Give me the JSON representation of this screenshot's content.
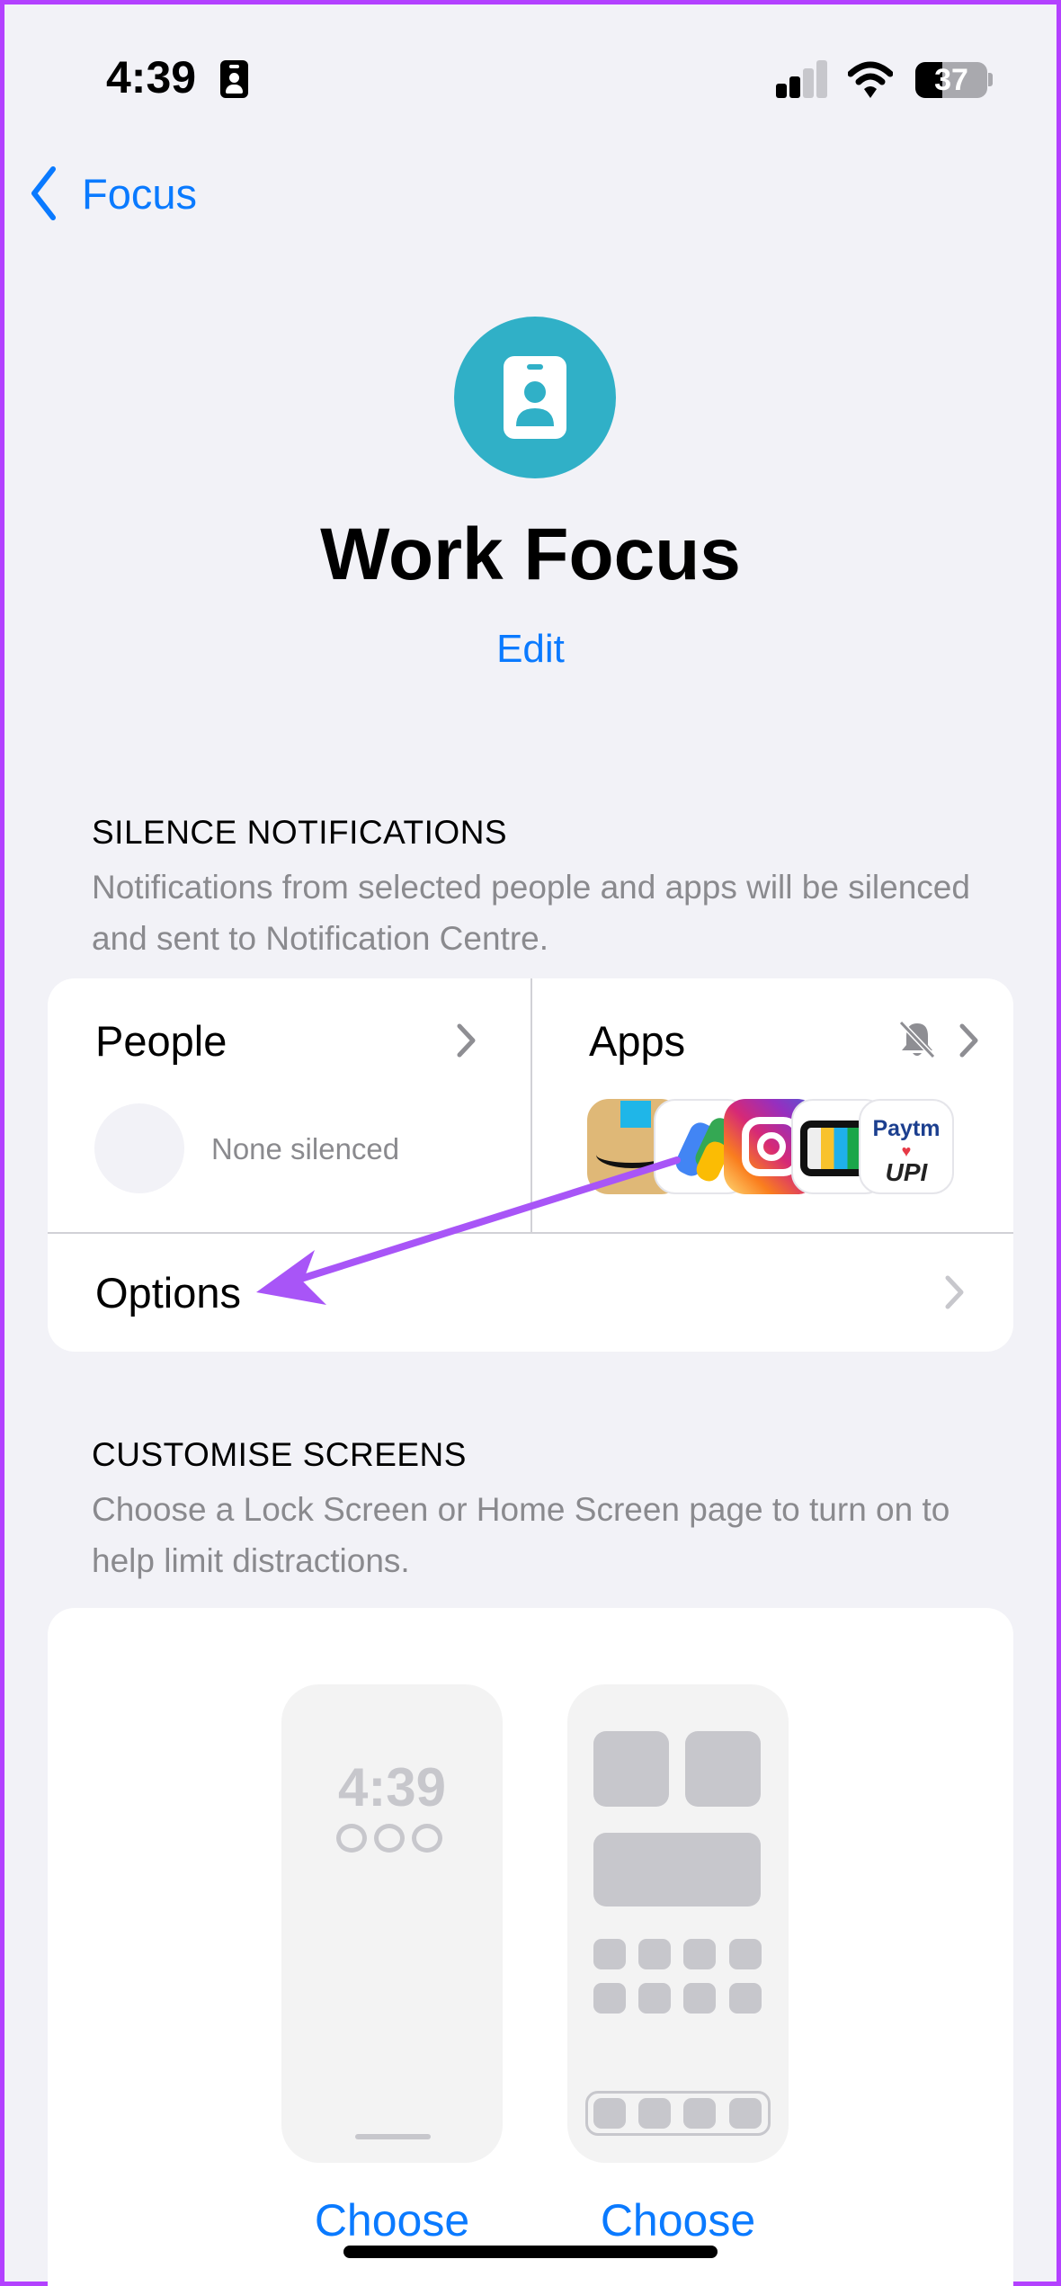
{
  "status_bar": {
    "time": "4:39",
    "battery": "37",
    "battery_level_percent": 37,
    "signal_bars": 2,
    "icons": [
      "focus-badge-icon",
      "cellular-signal-icon",
      "wifi-icon",
      "battery-icon"
    ]
  },
  "nav": {
    "back_label": "Focus"
  },
  "focus": {
    "icon": "id-badge-icon",
    "icon_color": "#30b0c7",
    "title": "Work Focus",
    "edit_label": "Edit"
  },
  "silence": {
    "header": "SILENCE NOTIFICATIONS",
    "description": "Notifications from selected people and apps will be silenced and sent to Notification Centre.",
    "people": {
      "label": "People",
      "status": "None silenced"
    },
    "apps": {
      "label": "Apps",
      "icon": "bell-slash-icon",
      "list": [
        "Amazon",
        "Google Pay",
        "Instagram",
        "TV",
        "Paytm UPI"
      ],
      "paytm_text": "Paytm",
      "upi_text": "UPI"
    },
    "options_label": "Options"
  },
  "customise": {
    "header": "CUSTOMISE SCREENS",
    "description": "Choose a Lock Screen or Home Screen page to turn on to help limit distractions.",
    "lock_preview_time": "4:39",
    "lock_choose": "Choose",
    "home_choose": "Choose"
  },
  "accent": "#0a7aff",
  "annotation_arrow_color": "#a855f7"
}
